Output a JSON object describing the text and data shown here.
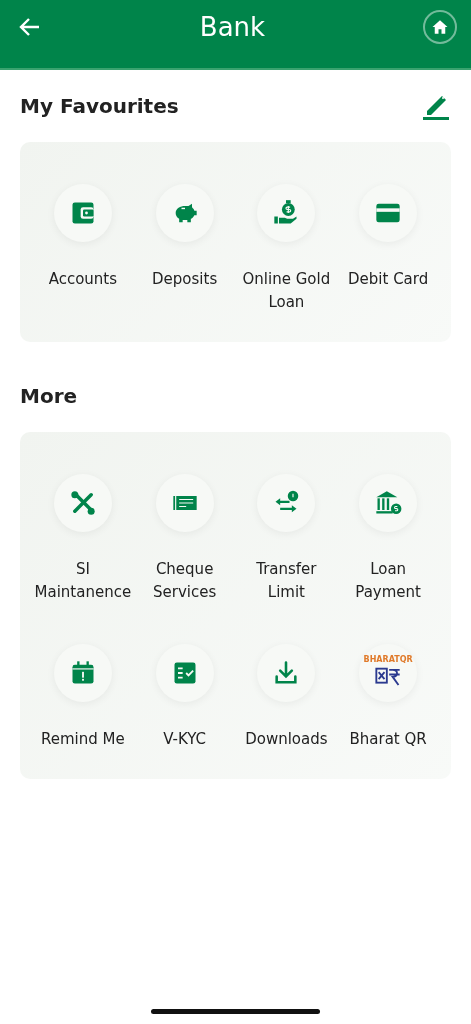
{
  "header": {
    "title": "Bank"
  },
  "sections": [
    {
      "title": "My Favourites",
      "editable": true,
      "items": [
        {
          "kind": "wallet",
          "label": "Accounts"
        },
        {
          "kind": "piggy",
          "label": "Deposits"
        },
        {
          "kind": "moneyhand",
          "label": "Online Gold Loan"
        },
        {
          "kind": "card",
          "label": "Debit Card"
        }
      ]
    },
    {
      "title": "More",
      "editable": false,
      "items": [
        {
          "kind": "tools",
          "label": "SI Maintanence"
        },
        {
          "kind": "cheque",
          "label": "Cheque Services"
        },
        {
          "kind": "transfer",
          "label": "Transfer Limit"
        },
        {
          "kind": "bank",
          "label": "Loan Payment"
        },
        {
          "kind": "calendar",
          "label": "Remind Me"
        },
        {
          "kind": "checklist",
          "label": "V-KYC"
        },
        {
          "kind": "download",
          "label": "Downloads"
        },
        {
          "kind": "qr",
          "label": "Bharat QR",
          "logo_text": "BHARATQR"
        }
      ]
    }
  ]
}
